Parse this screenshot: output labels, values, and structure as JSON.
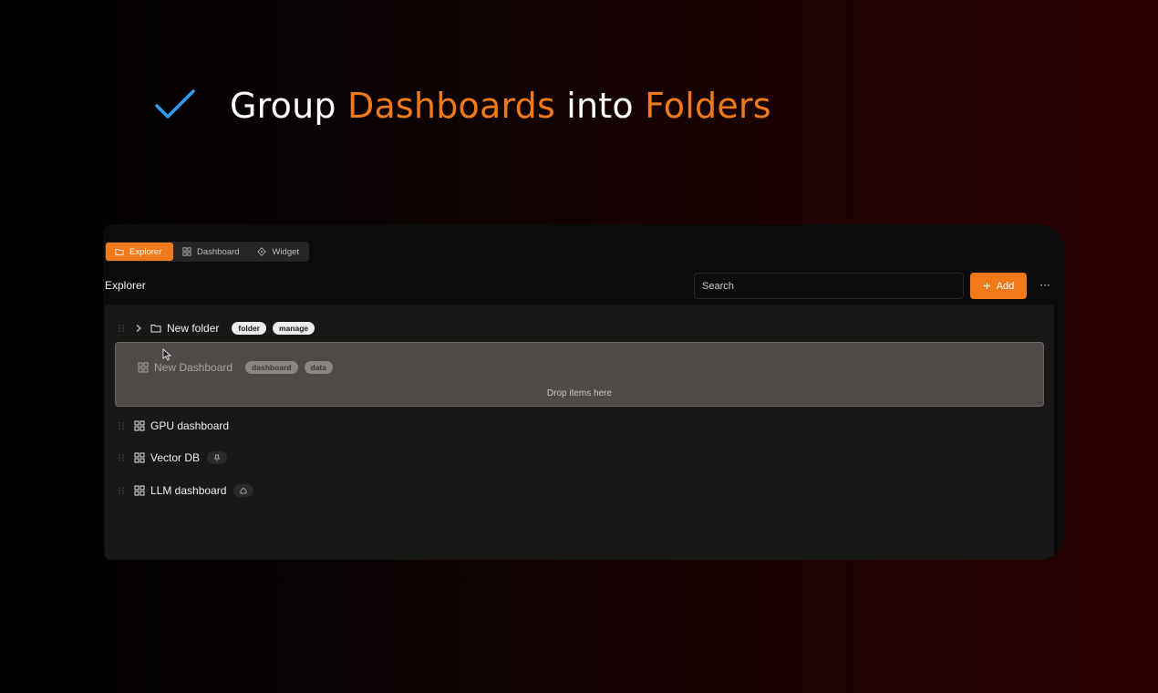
{
  "headline": {
    "word1": "Group",
    "word2": "Dashboards",
    "word3": "into",
    "word4": "Folders"
  },
  "tabs": [
    {
      "label": "Explorer",
      "icon": "folder-icon",
      "active": true
    },
    {
      "label": "Dashboard",
      "icon": "grid-icon",
      "active": false
    },
    {
      "label": "Widget",
      "icon": "widget-icon",
      "active": false
    }
  ],
  "explorer": {
    "title": "Explorer",
    "search_placeholder": "Search",
    "add_label": "Add",
    "more_label": "···"
  },
  "tree": {
    "folder": {
      "label": "New folder",
      "tags": [
        "folder",
        "manage"
      ]
    },
    "dragging": {
      "label": "New Dashboard",
      "tags": [
        "dashboard",
        "data"
      ]
    },
    "drop_text": "Drop items here",
    "items": [
      {
        "label": "GPU dashboard",
        "badge": null
      },
      {
        "label": "Vector DB",
        "badge": "pin-icon"
      },
      {
        "label": "LLM dashboard",
        "badge": "home-icon"
      }
    ]
  },
  "colors": {
    "accent": "#f07a1a",
    "check": "#2f9bf0",
    "panel": "#181816"
  }
}
